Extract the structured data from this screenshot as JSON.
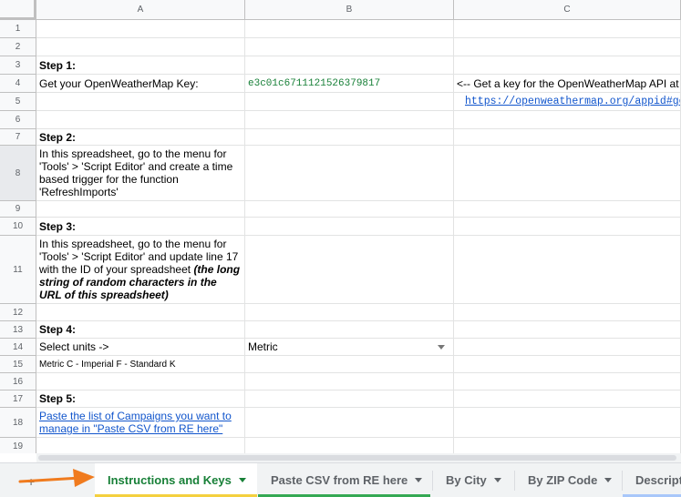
{
  "columns": [
    "A",
    "B",
    "C"
  ],
  "rows": [
    {
      "num": "1",
      "A": "",
      "B": "",
      "C": ""
    },
    {
      "num": "2",
      "A": "",
      "B": "",
      "C": ""
    },
    {
      "num": "3",
      "A": "Step 1:",
      "B": "",
      "C": ""
    },
    {
      "num": "4",
      "A": "Get your OpenWeatherMap Key:",
      "B": "e3c01c6711121526379817",
      "C": "<-- Get a key for the OpenWeatherMap API at"
    },
    {
      "num": "5",
      "A": "",
      "B": "",
      "C": "https://openweathermap.org/appid#get"
    },
    {
      "num": "6",
      "A": "",
      "B": "",
      "C": ""
    },
    {
      "num": "7",
      "A": "Step 2:",
      "B": "",
      "C": ""
    },
    {
      "num": "8",
      "A": "In this spreadsheet, go to the menu for 'Tools' > 'Script Editor' and create a time based trigger for the function 'RefreshImports'",
      "B": "",
      "C": ""
    },
    {
      "num": "9",
      "A": "",
      "B": "",
      "C": ""
    },
    {
      "num": "10",
      "A": "Step 3:",
      "B": "",
      "C": ""
    },
    {
      "num": "11",
      "A": "In this spreadsheet, go to the menu for 'Tools' > 'Script Editor' and update line 17 with the ID of your spreadsheet",
      "A_emph": "(the long string of random characters in the URL of this spreadsheet)",
      "B": "",
      "C": ""
    },
    {
      "num": "12",
      "A": "",
      "B": "",
      "C": ""
    },
    {
      "num": "13",
      "A": "Step 4:",
      "B": "",
      "C": ""
    },
    {
      "num": "14",
      "A": "Select units ->",
      "B": "Metric",
      "C": ""
    },
    {
      "num": "15",
      "A": "Metric C - Imperial F - Standard K",
      "B": "",
      "C": ""
    },
    {
      "num": "16",
      "A": "",
      "B": "",
      "C": ""
    },
    {
      "num": "17",
      "A": "Step 5:",
      "B": "",
      "C": ""
    },
    {
      "num": "18",
      "A": "Paste the list of Campaigns you want to manage in \"Paste CSV from RE here\"",
      "B": "",
      "C": ""
    },
    {
      "num": "19",
      "A": "",
      "B": "",
      "C": ""
    }
  ],
  "tabs": [
    {
      "label": "Instructions and Keys",
      "active": true,
      "color": "#f4d03f"
    },
    {
      "label": "Paste CSV from RE here",
      "active": false,
      "color": "#34a853"
    },
    {
      "label": "By City",
      "active": false,
      "color": ""
    },
    {
      "label": "By ZIP Code",
      "active": false,
      "color": ""
    },
    {
      "label": "Descript",
      "active": false,
      "color": "#a8c7fa"
    }
  ],
  "colors": {
    "accent": "#188038",
    "link": "#1155cc",
    "arrow": "#f07b1e"
  }
}
